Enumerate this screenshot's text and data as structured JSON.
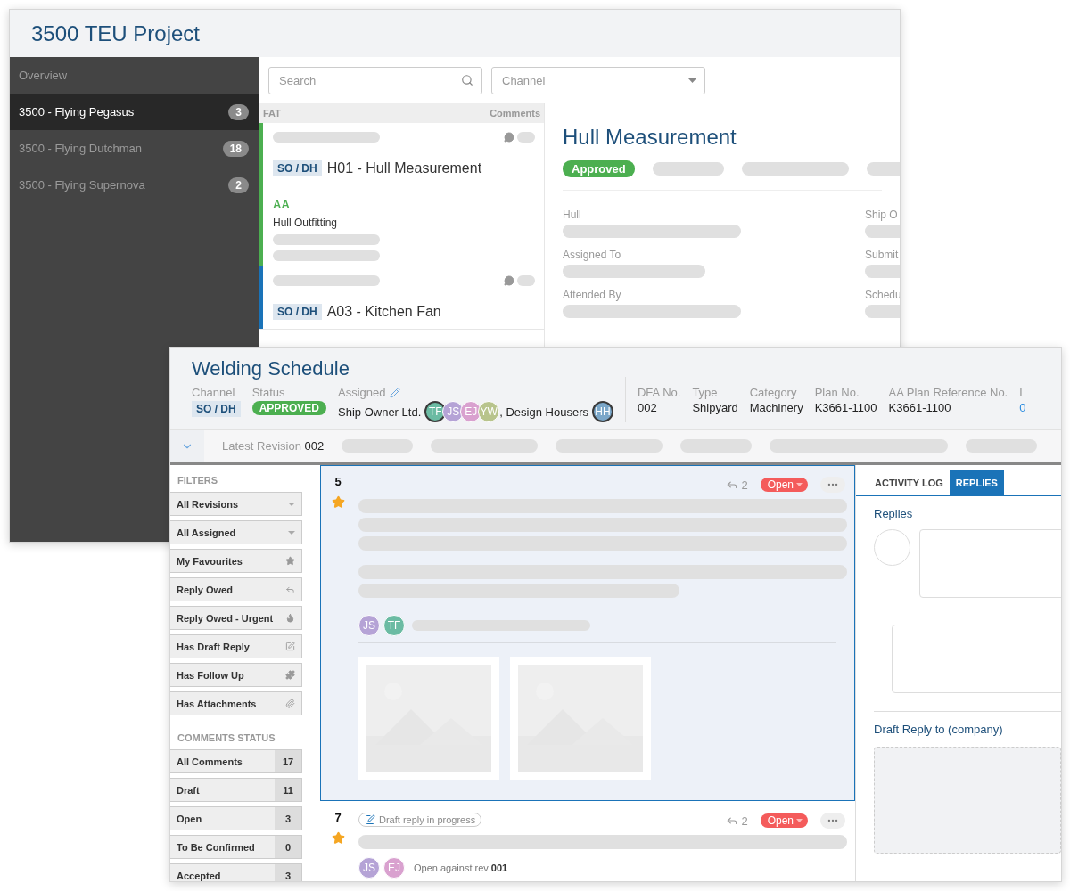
{
  "project_window": {
    "title": "3500 TEU Project",
    "sidebar": {
      "overview": "Overview",
      "items": [
        {
          "label": "3500 - Flying Pegasus",
          "count": "3",
          "selected": true
        },
        {
          "label": "3500 - Flying Dutchman",
          "count": "18",
          "selected": false
        },
        {
          "label": "3500 - Flying Supernova",
          "count": "2",
          "selected": false
        }
      ]
    },
    "search": {
      "placeholder": "Search"
    },
    "channel": {
      "placeholder": "Channel"
    },
    "list_header": {
      "column_1": "FAT",
      "column_2": "Comments"
    },
    "cards": [
      {
        "channel": "SO / DH",
        "title": "H01 - Hull Measurement",
        "discipline": "AA",
        "color": "#4caf50",
        "subtitle": "Hull Outfitting"
      },
      {
        "channel": "SO / DH",
        "title": "A03 - Kitchen Fan",
        "color": "#1a73b8"
      }
    ],
    "detail": {
      "title": "Hull Measurement",
      "status": "Approved",
      "fields": [
        {
          "label": "Hull"
        },
        {
          "label": "Assigned To"
        },
        {
          "label": "Attended By"
        }
      ],
      "side_fields": [
        {
          "label": "Ship O"
        },
        {
          "label": "Submit"
        },
        {
          "label": "Schedu"
        }
      ]
    }
  },
  "document_window": {
    "title": "Welding Schedule",
    "channel": {
      "label": "Channel",
      "value": "SO / DH"
    },
    "status": {
      "label": "Status",
      "value": "APPROVED"
    },
    "assigned": {
      "label": "Assigned",
      "groups": [
        {
          "company": "Ship Owner Ltd.",
          "avatars": [
            {
              "initials": "TF",
              "color": "#6bbba3",
              "highlighted": true
            },
            {
              "initials": "JS",
              "color": "#b5a3d6",
              "highlighted": false
            },
            {
              "initials": "EJ",
              "color": "#d9a1cf",
              "highlighted": false
            },
            {
              "initials": "YW",
              "color": "#b8c48c",
              "highlighted": false
            }
          ]
        },
        {
          "company": ", Design Housers",
          "avatars": [
            {
              "initials": "HH",
              "color": "#7ba7c9",
              "highlighted": true
            }
          ]
        }
      ]
    },
    "info": [
      {
        "label": "DFA No.",
        "value": "002"
      },
      {
        "label": "Type",
        "value": "Shipyard"
      },
      {
        "label": "Category",
        "value": "Machinery"
      },
      {
        "label": "Plan No.",
        "value": "K3661-1100"
      },
      {
        "label": "AA Plan Reference No.",
        "value": "K3661-1100"
      },
      {
        "label": "L",
        "value": "0",
        "kind": "link"
      }
    ],
    "revision": {
      "label": "Latest Revision",
      "value": "002"
    },
    "filters": {
      "heading": "FILTERS",
      "items": [
        {
          "label": "All Revisions"
        },
        {
          "label": "All Assigned"
        },
        {
          "label": "My Favourites"
        },
        {
          "label": "Reply Owed"
        },
        {
          "label": "Reply Owed - Urgent"
        },
        {
          "label": "Has Draft Reply"
        },
        {
          "label": "Has Follow Up"
        },
        {
          "label": "Has Attachments"
        }
      ]
    },
    "comments_status": {
      "heading": "COMMENTS STATUS",
      "items": [
        {
          "label": "All Comments",
          "count": "17"
        },
        {
          "label": "Draft",
          "count": "11"
        },
        {
          "label": "Open",
          "count": "3"
        },
        {
          "label": "To Be Confirmed",
          "count": "0"
        },
        {
          "label": "Accepted",
          "count": "3"
        }
      ]
    },
    "comments": [
      {
        "number": "5",
        "starred": true,
        "selected": true,
        "replies": "2",
        "status": "Open",
        "avatars": [
          {
            "initials": "JS",
            "color": "#b5a3d6"
          },
          {
            "initials": "TF",
            "color": "#6bbba3"
          }
        ],
        "attachments": [
          {
            "kind": "picture"
          },
          {
            "kind": "picture"
          }
        ]
      },
      {
        "number": "7",
        "starred": true,
        "selected": false,
        "draft": "Draft reply in progress",
        "replies": "2",
        "status": "Open",
        "avatars": [
          {
            "initials": "JS",
            "color": "#b5a3d6"
          },
          {
            "initials": "EJ",
            "color": "#d9a1cf"
          }
        ],
        "note": "Open against rev **001**"
      }
    ],
    "tabs": [
      {
        "label": "ACTIVITY LOG",
        "selected": false
      },
      {
        "label": "REPLIES",
        "selected": true
      }
    ],
    "replies_heading": "Replies",
    "draft_heading": "Draft Reply to (company)"
  }
}
